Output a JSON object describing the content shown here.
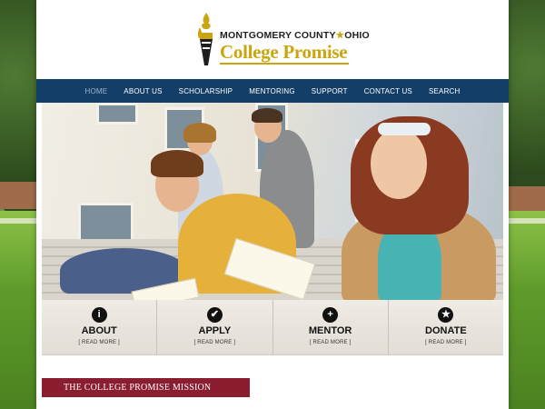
{
  "logo": {
    "county_line": "MONTGOMERY COUNTY",
    "star": "★",
    "state": "OHIO",
    "program": "College Promise"
  },
  "nav": {
    "items": [
      {
        "label": "HOME",
        "active": true
      },
      {
        "label": "ABOUT US"
      },
      {
        "label": "SCHOLARSHIP"
      },
      {
        "label": "MENTORING"
      },
      {
        "label": "SUPPORT"
      },
      {
        "label": "CONTACT US"
      },
      {
        "label": "SEARCH"
      }
    ]
  },
  "features": [
    {
      "icon": "info-icon",
      "glyph": "i",
      "title": "ABOUT",
      "more": "[ READ MORE ]"
    },
    {
      "icon": "check-icon",
      "glyph": "✔",
      "title": "APPLY",
      "more": "[ READ MORE ]"
    },
    {
      "icon": "plus-icon",
      "glyph": "+",
      "title": "MENTOR",
      "more": "[ READ MORE ]"
    },
    {
      "icon": "star-icon",
      "glyph": "★",
      "title": "DONATE",
      "more": "[ READ MORE ]"
    }
  ],
  "mission": {
    "heading": "THE COLLEGE PROMISE MISSION"
  },
  "colors": {
    "nav": "#133e68",
    "gold": "#c9a60f",
    "mission": "#8b1d30"
  }
}
